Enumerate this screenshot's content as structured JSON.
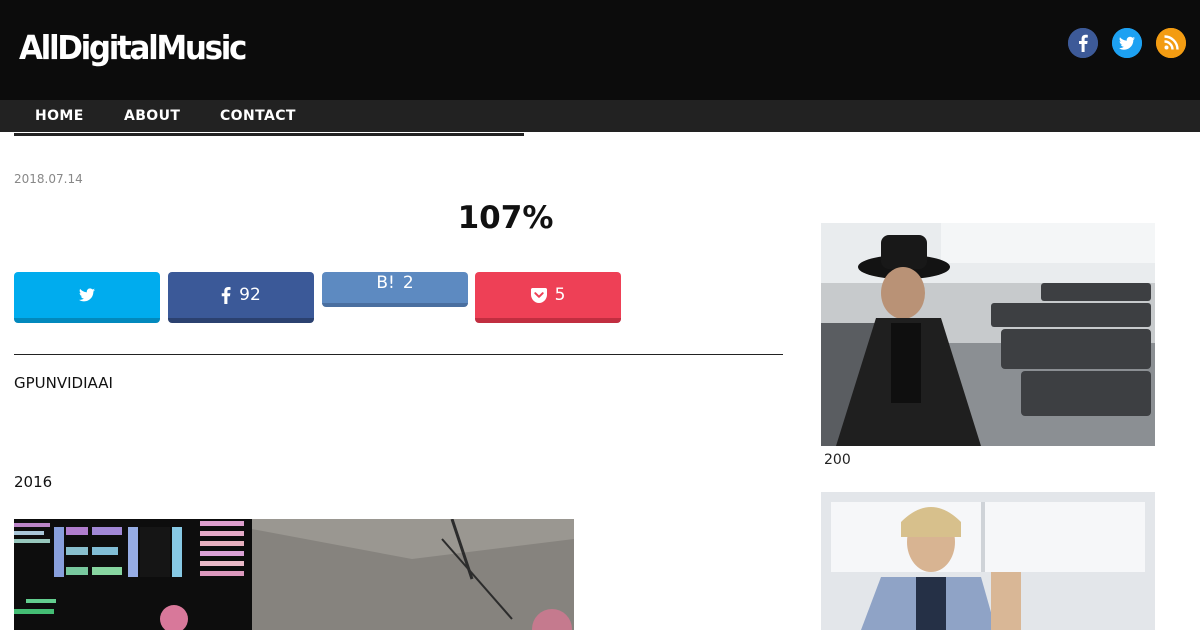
{
  "header": {
    "logo_text": "AllDigitalMusic",
    "social": [
      {
        "icon": "facebook-icon",
        "color": "#3b5998"
      },
      {
        "icon": "twitter-icon",
        "color": "#1da1f2"
      },
      {
        "icon": "rss-icon",
        "color": "#f39c12"
      }
    ]
  },
  "nav": {
    "items": [
      "HOME",
      "ABOUT",
      "CONTACT"
    ]
  },
  "article": {
    "date": "2018.07.14",
    "title": "107%",
    "share": {
      "twitter": {
        "label": "",
        "color": "#00acee"
      },
      "facebook": {
        "count": "92",
        "color": "#3b5998"
      },
      "hatena": {
        "label": "B!",
        "count": "2",
        "color": "#5d8ac1"
      },
      "pocket": {
        "count": "5",
        "color": "#ee4056"
      }
    },
    "paragraphs": [
      "GPUNVIDIAAI",
      "2016"
    ]
  },
  "sidebar": {
    "items": [
      {
        "caption": "200"
      },
      {
        "caption": ""
      }
    ]
  }
}
